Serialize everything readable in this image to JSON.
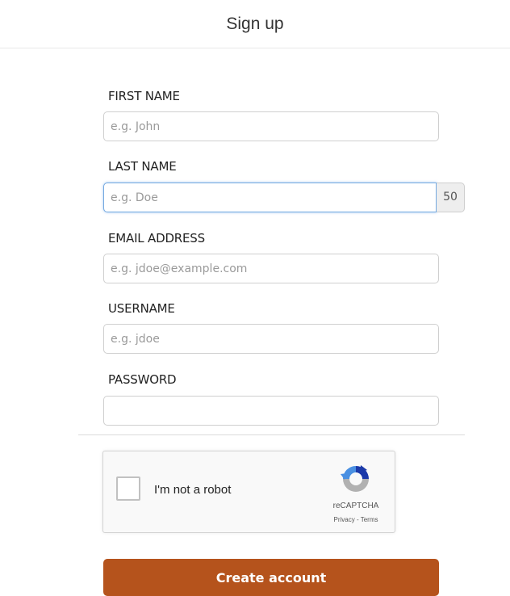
{
  "page": {
    "title": "Sign up"
  },
  "form": {
    "first_name": {
      "label": "FIRST NAME",
      "placeholder": "e.g. John",
      "value": ""
    },
    "last_name": {
      "label": "LAST NAME",
      "placeholder": "e.g. Doe",
      "value": "",
      "char_counter": "50"
    },
    "email": {
      "label": "EMAIL ADDRESS",
      "placeholder": "e.g. jdoe@example.com",
      "value": ""
    },
    "username": {
      "label": "USERNAME",
      "placeholder": "e.g. jdoe",
      "value": ""
    },
    "password": {
      "label": "PASSWORD",
      "placeholder": "",
      "value": ""
    },
    "submit_label": "Create account"
  },
  "captcha": {
    "label": "I'm not a robot",
    "brand": "reCAPTCHA",
    "links": "Privacy - Terms",
    "checked": false
  },
  "colors": {
    "accent": "#b5531c",
    "focus_border": "#74a9e0",
    "recaptcha_blue": "#1c3aa9",
    "recaptcha_light_blue": "#4a90e2",
    "recaptcha_gray": "#b1b1b1"
  }
}
